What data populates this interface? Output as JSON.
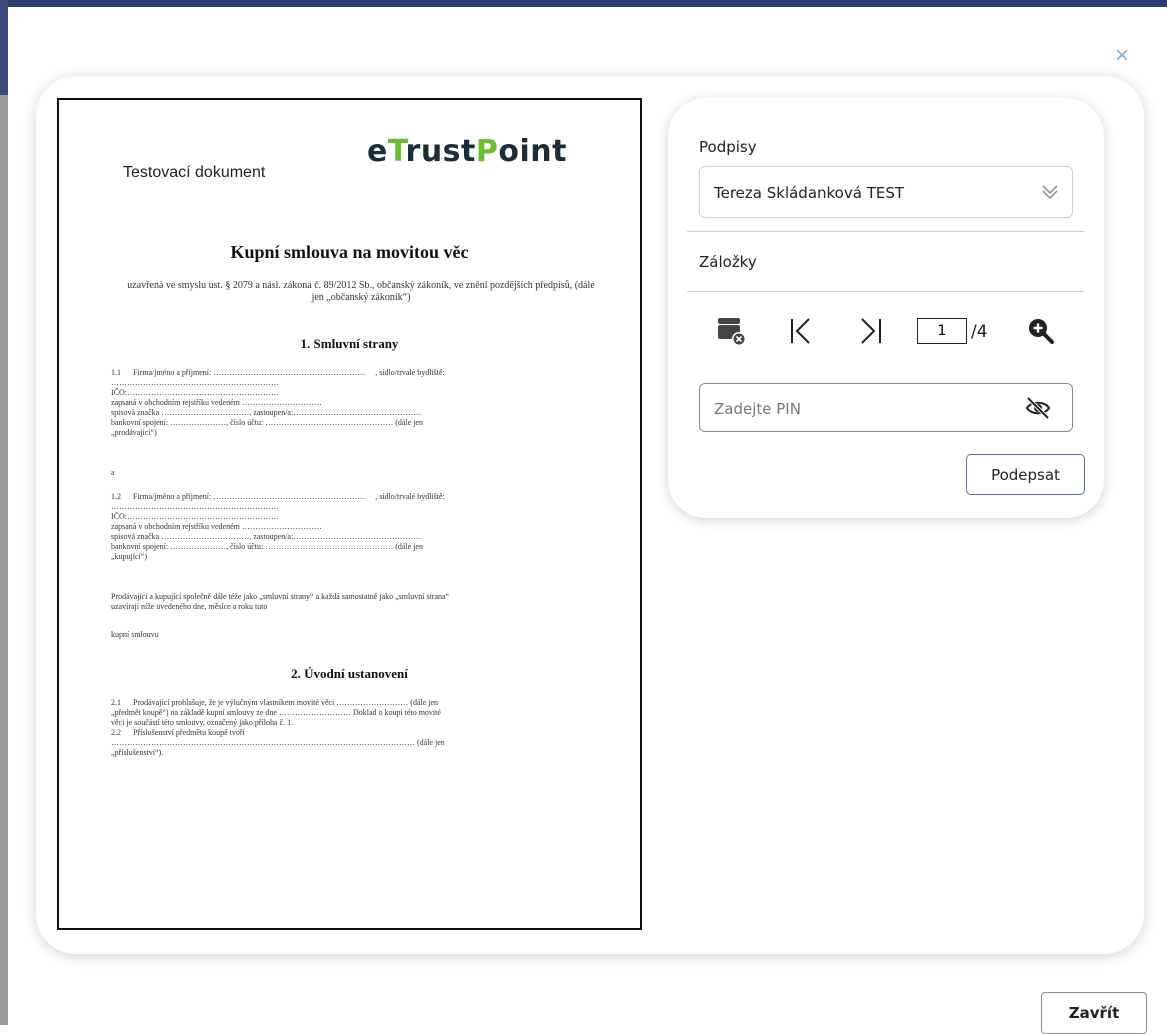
{
  "dialog": {
    "close_icon": "×",
    "close_button_label": "Zavřít"
  },
  "document": {
    "header_text": "Testovací dokument",
    "logo_part1": "e",
    "logo_part2": "T",
    "logo_part3": "rust",
    "logo_part4": "P",
    "logo_part5": "oint",
    "title": "Kupní smlouva na movitou věc",
    "subtitle": "uzavřená ve smyslu ust. § 2079 a násl. zákona č. 89/2012 Sb., občanský zákoník, ve znění pozdějších předpisů, (dále jen „občanský zákoník“)",
    "section1": "1. Smluvní strany",
    "p1_1": "1.1      Firma/jméno a příjmení: …………………………………………………     , sídlo/trvalé bydliště:\n………………………………………………………\nIČO:…………………………………………………\nzapsaná v obchodním rejstříku vedeném …………………………\nspisová značka ……………………………, zastoupen/a:…………………………………………\nbankovní spojení: …………………, číslo účtu: ………………………………………… (dále jen\n„prodávající“)",
    "p_a": "a",
    "p1_2": "1.2      Firma/jméno a příjmení: …………………………………………………     , sídlo/trvalé bydliště:\n………………………………………………………\nIČO:…………………………………………………\nzapsaná v obchodním rejstříku vedeném …………………………\nspisová značka ……………………………, zastoupen/a:…………………………………………\nbankovní spojení: …………………, číslo účtu: ………………………………………… (dále jen\n„kupující“)",
    "p_parties": "Prodávající a kupující společně dále téže jako „smluvní strany“ a každá samostatně jako „smluvní strana“\nuzavírají níže uvedeného dne, měsíce a roku tuto",
    "p_contract": "kupní smlouvu",
    "section2": "2. Úvodní ustanovení",
    "p2": "2.1      Prodávající prohlašuje, že je výlučným vlastníkem movité věci ……………………… (dále jen\n„předmět koupě“) na základě kupní smlouvy ze dne ……………………… Doklad o koupi této movité\nvěci je součástí této smlouvy, označený jako příloha č. 1.\n2.2      Příslušenství předmětu koupě tvoří\n…………………………………………………………………………………………………… (dále jen\n„příslušenství“)."
  },
  "panel": {
    "signatures_label": "Podpisy",
    "signature_selected": "Tereza Skládanková TEST",
    "bookmarks_label": "Záložky",
    "page_current": "1",
    "page_total": "/4",
    "pin_placeholder": "Zadejte PIN",
    "sign_button_label": "Podepsat"
  },
  "colors": {
    "accent_border": "#5a6fa8",
    "logo_green": "#6cbf2c",
    "logo_dark": "#1c2d3a",
    "top_bar": "#2d3d6e"
  },
  "icons": {
    "calendar_cancel": "calendar-cancel-icon",
    "first_page": "first-page-icon",
    "last_page": "last-page-icon",
    "zoom_in": "zoom-in-icon",
    "eye_off": "eye-off-icon",
    "chevron_double_down": "chevron-double-down-icon",
    "close": "close-icon"
  }
}
